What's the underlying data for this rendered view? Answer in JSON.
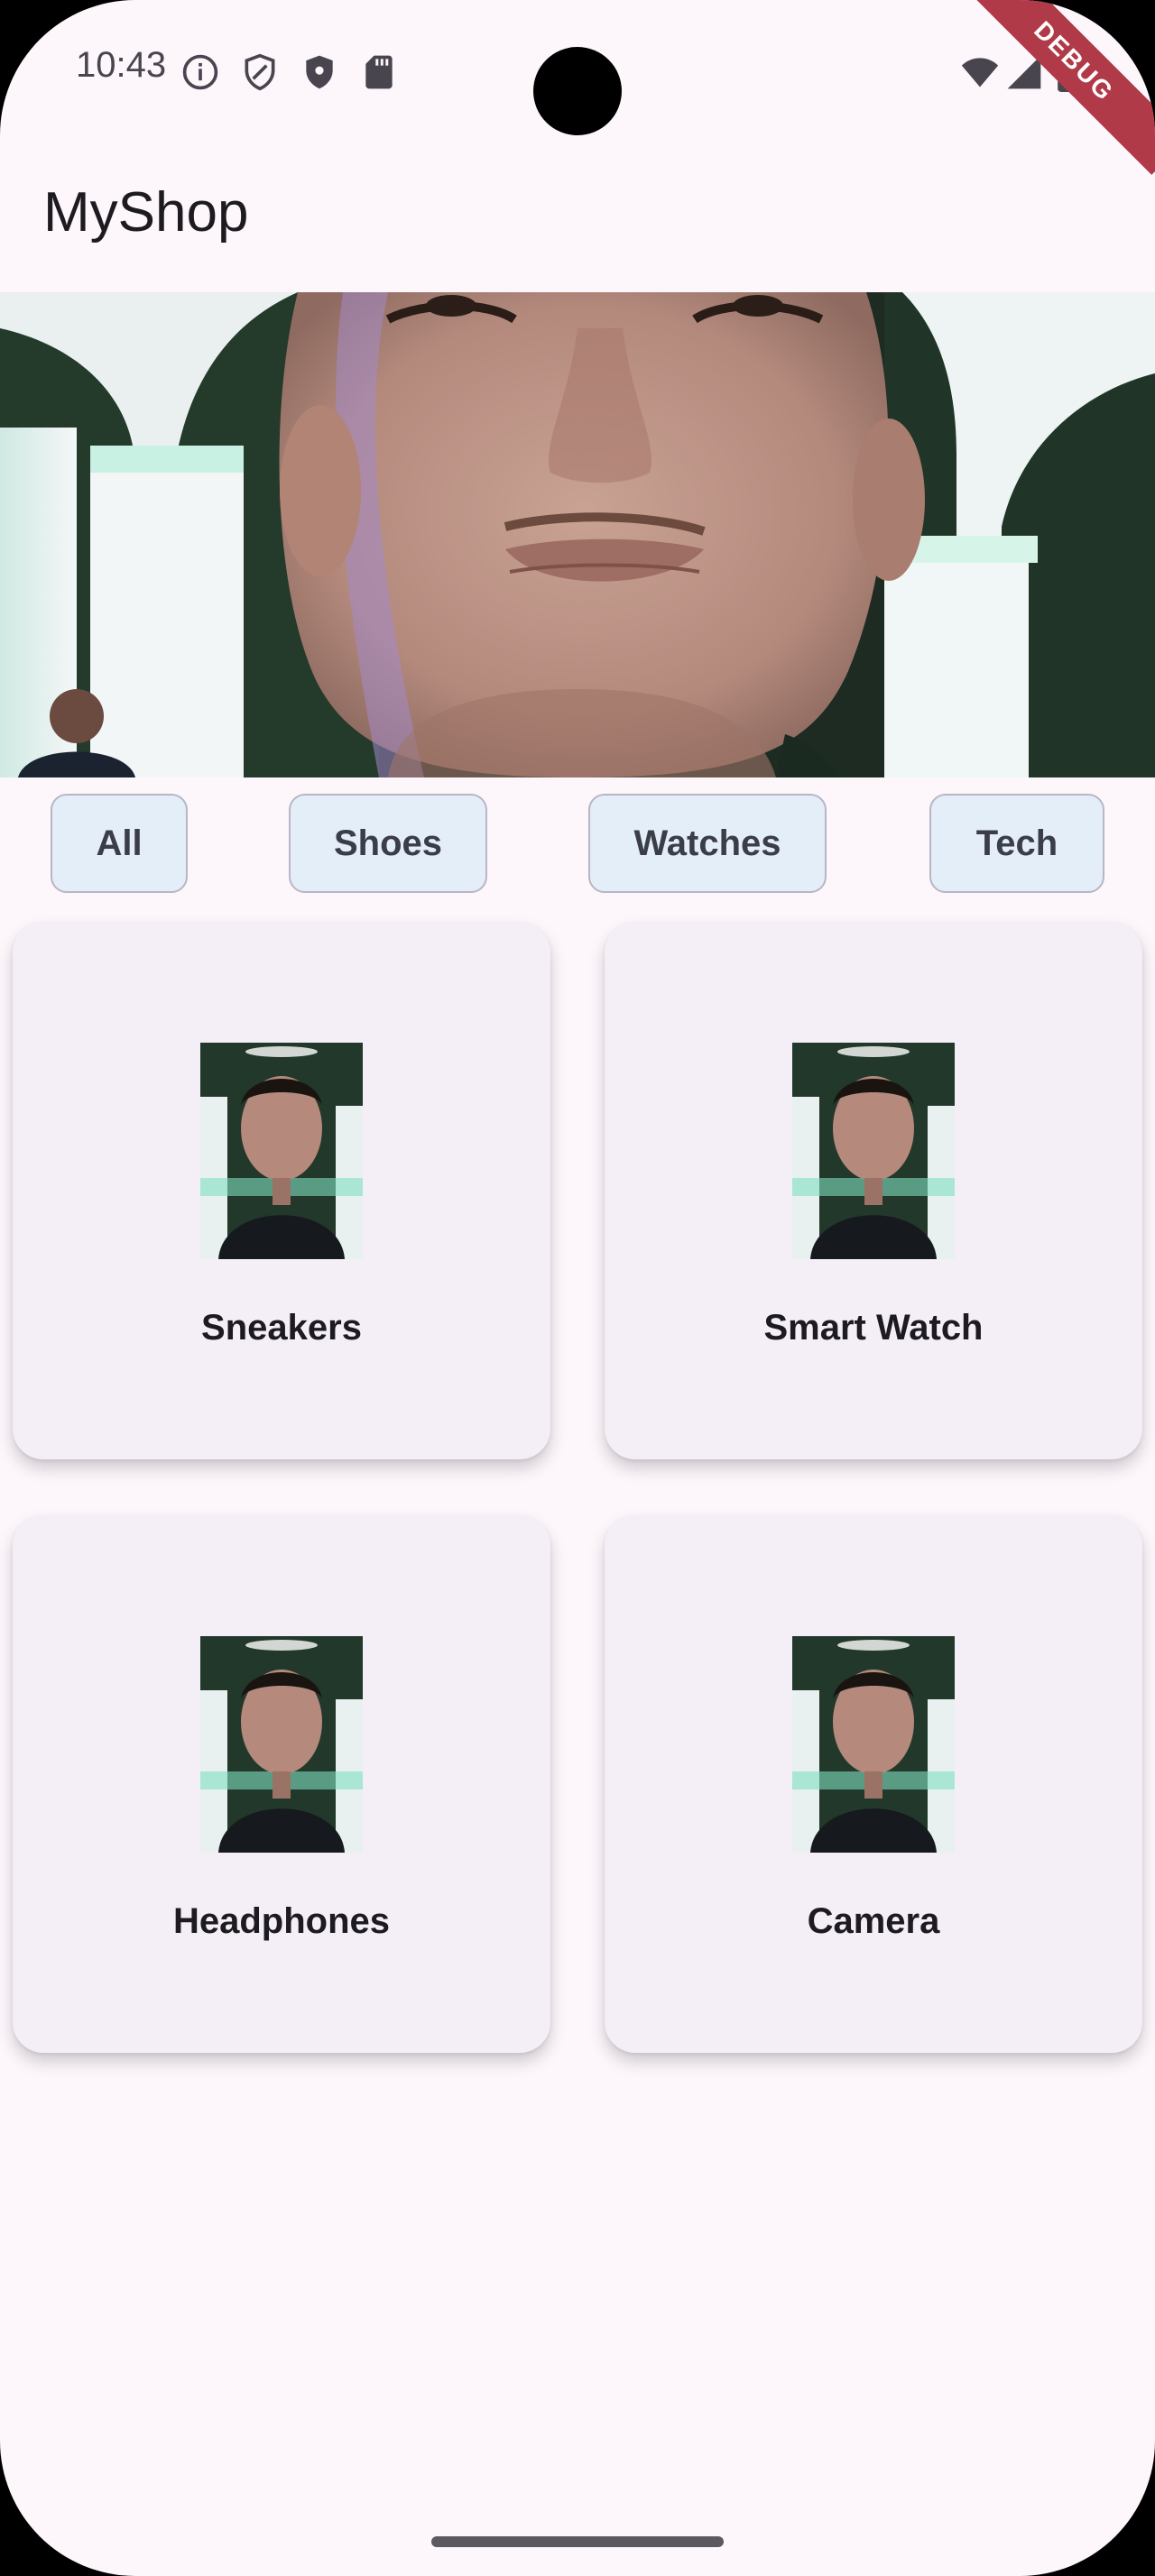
{
  "status_bar": {
    "time": "10:43",
    "left_icons": [
      "info-icon",
      "shield-outline-icon",
      "shield-filled-icon",
      "sd-card-icon"
    ],
    "right_icons": [
      "wifi-icon",
      "signal-icon",
      "battery-icon"
    ],
    "debug_banner": "DEBUG"
  },
  "app_bar": {
    "title": "MyShop"
  },
  "categories": [
    {
      "label": "All"
    },
    {
      "label": "Shoes"
    },
    {
      "label": "Watches"
    },
    {
      "label": "Tech"
    }
  ],
  "products": [
    {
      "name": "Sneakers"
    },
    {
      "name": "Smart Watch"
    },
    {
      "name": "Headphones"
    },
    {
      "name": "Camera"
    }
  ],
  "colors": {
    "background": "#fdf7fc",
    "card": "#f4eff7",
    "chip": "#e3eef9",
    "debug": "#b03a48"
  }
}
